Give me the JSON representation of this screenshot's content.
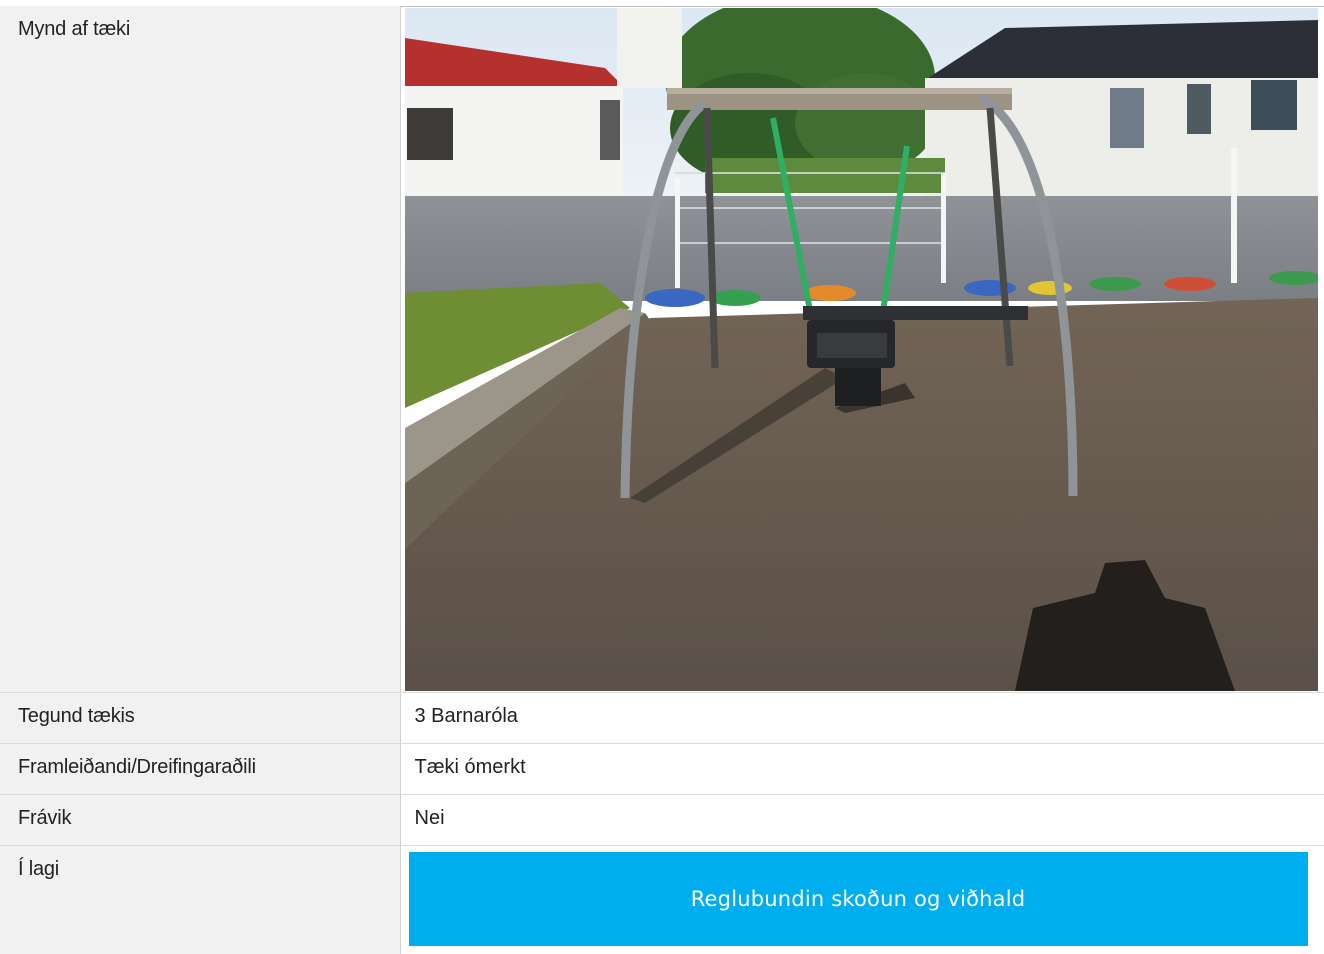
{
  "rows": [
    {
      "label": "Mynd af tæki",
      "type": "image",
      "image_alt": "Ungbarnaróla á sandsvæði"
    },
    {
      "label": "Tegund tækis",
      "value": "3 Barnaróla"
    },
    {
      "label": "Framleiðandi/Dreifingaraðili",
      "value": "Tæki ómerkt"
    },
    {
      "label": "Frávik",
      "value": "Nei"
    },
    {
      "label": "Í lagi",
      "button_label": "Reglubundin skoðun og viðhald"
    }
  ],
  "colors": {
    "button_bg": "#00aeef",
    "label_bg": "#f1f1f1"
  }
}
